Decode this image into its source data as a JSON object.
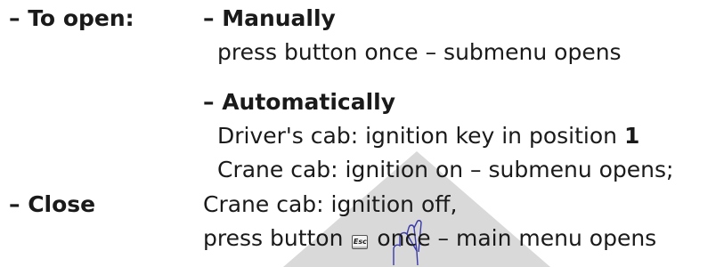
{
  "watermark_color": "#d9d9d9",
  "watermark_icon": "hand-pointer-icon",
  "rows": {
    "open": {
      "label": "– To open:",
      "manual_title": "– Manually",
      "manual_text": "press button once – submenu opens",
      "auto_title": "– Automatically",
      "auto_line1_prefix": "Driver's cab: ignition key in position",
      "auto_line1_value": "1",
      "auto_line2": "Crane cab: ignition on – submenu opens;"
    },
    "close": {
      "label": "– Close",
      "line1": "Crane cab: ignition off,",
      "line2_prefix": "press button",
      "key_icon_label": "Esc",
      "line2_suffix": "once – main menu opens"
    }
  }
}
